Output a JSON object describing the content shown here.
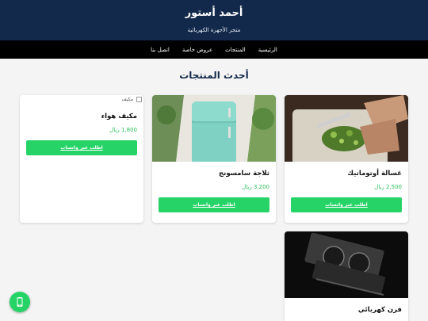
{
  "header": {
    "title": "أحمد أستور",
    "subtitle": "متجر الأجهزة الكهربائية"
  },
  "nav": {
    "items": [
      "الرئيسية",
      "المنتجات",
      "عروض خاصة",
      "اتصل بنا"
    ]
  },
  "section": {
    "title": "أحدث المنتجات"
  },
  "products": [
    {
      "name": "غسالة أوتوماتيك",
      "price": "2,500 ريال",
      "button": "اطلب عبر واتساب"
    },
    {
      "name": "ثلاجة سامسونج",
      "price": "3,200 ريال",
      "button": "اطلب عبر واتساب"
    },
    {
      "name": "مكيف هواء",
      "price": "1,800 ريال",
      "button": "اطلب عبر واتساب",
      "image_alt": "مكيف"
    },
    {
      "name": "فرن كهربائي"
    }
  ],
  "colors": {
    "header_bg": "#13294b",
    "nav_bg": "#000000",
    "accent_green": "#25d366"
  },
  "fab": {
    "icon": "whatsapp-icon"
  }
}
